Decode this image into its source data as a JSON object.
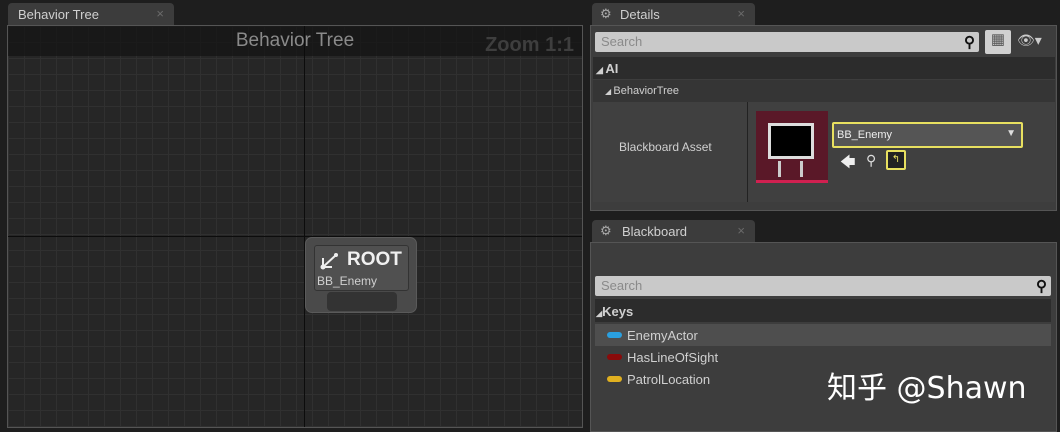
{
  "graph_tab": {
    "label": "Behavior Tree",
    "close": "×"
  },
  "graph": {
    "title": "Behavior Tree",
    "zoom": "Zoom 1:1",
    "root_node": {
      "title": "ROOT",
      "subtitle": "BB_Enemy"
    }
  },
  "details_tab": {
    "label": "Details",
    "close": "×"
  },
  "details": {
    "search_placeholder": "Search",
    "category": "AI",
    "subcategory": "BehaviorTree",
    "property_label": "Blackboard Asset",
    "asset_value": "BB_Enemy"
  },
  "blackboard_tab": {
    "label": "Blackboard",
    "close": "×"
  },
  "blackboard": {
    "search_placeholder": "Search",
    "keys_header": "Keys",
    "keys": [
      {
        "name": "EnemyActor",
        "color": "#2aa0e0"
      },
      {
        "name": "HasLineOfSight",
        "color": "#8a0a0a"
      },
      {
        "name": "PatrolLocation",
        "color": "#e0b020"
      }
    ]
  },
  "watermark": "知乎 @Shawn"
}
